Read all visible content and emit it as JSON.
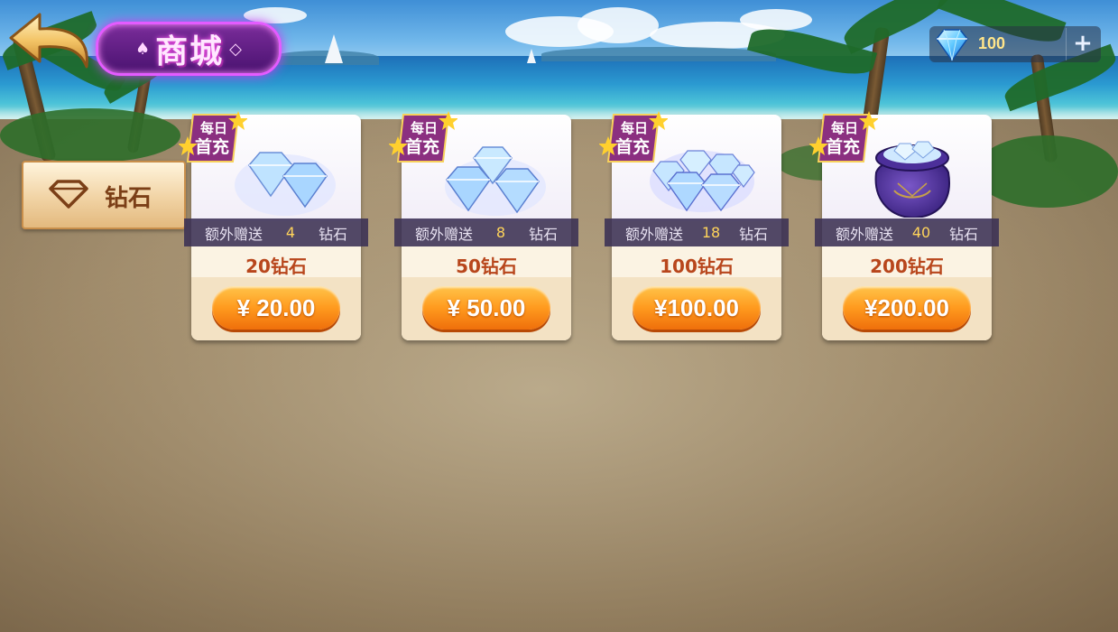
{
  "header": {
    "title": "商城",
    "back_icon": "back-arrow-icon"
  },
  "currency": {
    "icon": "diamond-icon",
    "amount": "100",
    "add_label": "+"
  },
  "sidebar": {
    "tabs": [
      {
        "label": "钻石",
        "icon": "diamond-outline-icon",
        "selected": true
      }
    ]
  },
  "badge": {
    "line1": "每日",
    "line2": "首充"
  },
  "products": [
    {
      "bonus_prefix": "额外赠送",
      "bonus_amount": "4",
      "bonus_unit": "钻石",
      "name": "20钻石",
      "price": "¥ 20.00",
      "art": "diamond-pile-small-icon"
    },
    {
      "bonus_prefix": "额外赠送",
      "bonus_amount": "8",
      "bonus_unit": "钻石",
      "name": "50钻石",
      "price": "¥ 50.00",
      "art": "diamond-pile-medium-icon"
    },
    {
      "bonus_prefix": "额外赠送",
      "bonus_amount": "18",
      "bonus_unit": "钻石",
      "name": "100钻石",
      "price": "¥100.00",
      "art": "diamond-pile-large-icon"
    },
    {
      "bonus_prefix": "额外赠送",
      "bonus_amount": "40",
      "bonus_unit": "钻石",
      "name": "200钻石",
      "price": "¥200.00",
      "art": "diamond-bag-icon"
    }
  ],
  "colors": {
    "title_glow": "#e45bff",
    "price_button": "#ff9a1e",
    "product_name": "#b8461c",
    "bonus_number": "#ffd45a",
    "currency_value": "#ffe58a"
  }
}
